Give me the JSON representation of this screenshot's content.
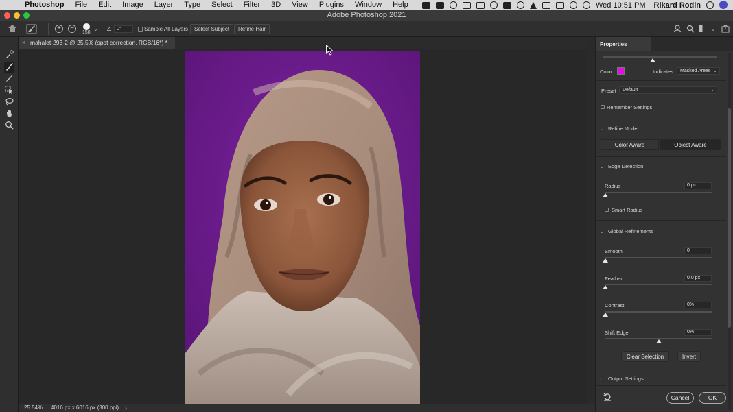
{
  "menubar": {
    "apple_glyph": "",
    "app_name": "Photoshop",
    "items": [
      "File",
      "Edit",
      "Image",
      "Layer",
      "Type",
      "Select",
      "Filter",
      "3D",
      "View",
      "Plugins",
      "Window",
      "Help"
    ],
    "clock": "Wed 10:51 PM",
    "user": "Rikard Rodin"
  },
  "window": {
    "title": "Adobe Photoshop 2021"
  },
  "options_bar": {
    "brush_size": "158",
    "angle": "0°",
    "sample_all_layers_label": "Sample All Layers",
    "sample_all_layers_checked": false,
    "select_subject_label": "Select Subject",
    "refine_hair_label": "Refine Hair"
  },
  "document": {
    "tab_title": "mahalet-293-2 @ 25.5% (spot correction, RGB/16*) *",
    "backdrop_color": "#6a1d8c"
  },
  "status_bar": {
    "zoom": "25.54%",
    "doc_info": "4016 px x 6016 px (300 ppi)"
  },
  "properties": {
    "tab_label": "Properties",
    "opacity_level": 0.44,
    "color_label": "Color",
    "color_swatch": "#e10fe0",
    "indicates_label": "Indicates",
    "indicates_value": "Masked Areas",
    "preset_label": "Preset",
    "preset_value": "Default",
    "remember_settings_label": "Remember Settings",
    "refine_mode": {
      "title": "Refine Mode",
      "color_aware": "Color Aware",
      "object_aware": "Object Aware",
      "selected": "Object Aware"
    },
    "edge_detection": {
      "title": "Edge Detection",
      "radius_label": "Radius",
      "radius_value": "0 px",
      "radius_level": 0,
      "smart_radius_label": "Smart Radius"
    },
    "global_refinements": {
      "title": "Global Refinements",
      "smooth_label": "Smooth",
      "smooth_value": "0",
      "smooth_level": 0,
      "feather_label": "Feather",
      "feather_value": "0.0 px",
      "feather_level": 0,
      "contrast_label": "Contrast",
      "contrast_value": "0%",
      "contrast_level": 0,
      "shift_edge_label": "Shift Edge",
      "shift_edge_value": "0%",
      "shift_edge_level": 0.5
    },
    "clear_selection_label": "Clear Selection",
    "invert_label": "Invert",
    "output_settings_label": "Output Settings",
    "cancel_label": "Cancel",
    "ok_label": "OK"
  }
}
